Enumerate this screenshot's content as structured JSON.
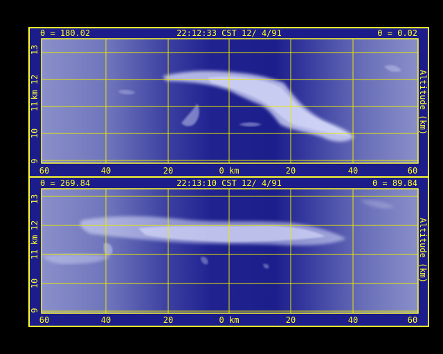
{
  "colors": {
    "background": "#000000",
    "border": "#ffff2a",
    "header_bar": "#1c1c8a",
    "plot_dark": "#1f1f8c",
    "plot_edge": "#7a7fc0",
    "cloud": "#e0e4ff",
    "label": "#ffff2a"
  },
  "panels": [
    {
      "id": "top",
      "theta_left": "θ = 180.02",
      "timestamp": "22:12:33 CST 12/ 4/91",
      "theta_right": "θ = 0.02",
      "y_ticks": [
        "13",
        "12",
        "11",
        "10",
        "9"
      ],
      "y_label_left": "km",
      "y_label_right": "Altitude (km)",
      "x_ticks": [
        "60",
        "40",
        "20",
        "0 km",
        "20",
        "40",
        "60"
      ]
    },
    {
      "id": "bottom",
      "theta_left": "θ = 269.84",
      "timestamp": "22:13:10 CST 12/ 4/91",
      "theta_right": "θ = 89.84",
      "y_ticks": [
        "13",
        "12",
        "11",
        "10",
        "9"
      ],
      "y_label_left": "km",
      "y_label_right": "Altitude (km)",
      "x_ticks": [
        "60",
        "40",
        "20",
        "0 km",
        "20",
        "40",
        "60"
      ]
    }
  ]
}
